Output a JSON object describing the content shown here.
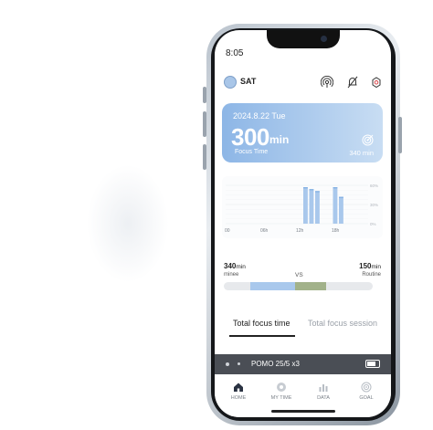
{
  "status_bar": {
    "time": "8:05"
  },
  "header": {
    "username": "SAT",
    "icons": [
      "broadcast-icon",
      "bell-off-icon",
      "timer-settings-icon"
    ]
  },
  "summary": {
    "date": "2024.8.22 Tue",
    "focus_value": "300",
    "focus_unit": "min",
    "focus_label": "Focus Time",
    "goal_value": "340 min",
    "icon": "target-icon"
  },
  "chart_data": {
    "type": "bar",
    "x_ticks": [
      "00",
      "06h",
      "12h",
      "18h"
    ],
    "y_ticks": [
      "60%",
      "30%",
      "0%"
    ],
    "hours": [
      13,
      14,
      15,
      18,
      19
    ],
    "values": [
      0.95,
      0.9,
      0.85,
      0.95,
      0.7
    ],
    "colors": {
      "bar": "#a9c8ec",
      "bar_dark": "#7faee3",
      "grid": "#e6eaee"
    }
  },
  "comparison": {
    "left_value": "340",
    "left_unit": "min",
    "left_name": "minee",
    "vs_label": "VS",
    "right_value": "150",
    "right_unit": "min",
    "right_name": "Routine",
    "colors": {
      "left": "#a9c8ec",
      "right": "#a2b28a",
      "track": "#e7e9ec"
    },
    "left_fraction": 0.3,
    "right_fraction": 0.21
  },
  "tabs": [
    {
      "label": "Total focus time",
      "active": true
    },
    {
      "label": "Total focus session",
      "active": false
    }
  ],
  "timer_bar": {
    "label": "POMO 25/5 x3"
  },
  "bottom_nav": [
    {
      "label": "HOME",
      "icon": "home-icon",
      "active": true
    },
    {
      "label": "MY TIME",
      "icon": "clock-icon",
      "active": false
    },
    {
      "label": "DATA",
      "icon": "chart-icon",
      "active": false
    },
    {
      "label": "GOAL",
      "icon": "target-icon",
      "active": false
    }
  ]
}
